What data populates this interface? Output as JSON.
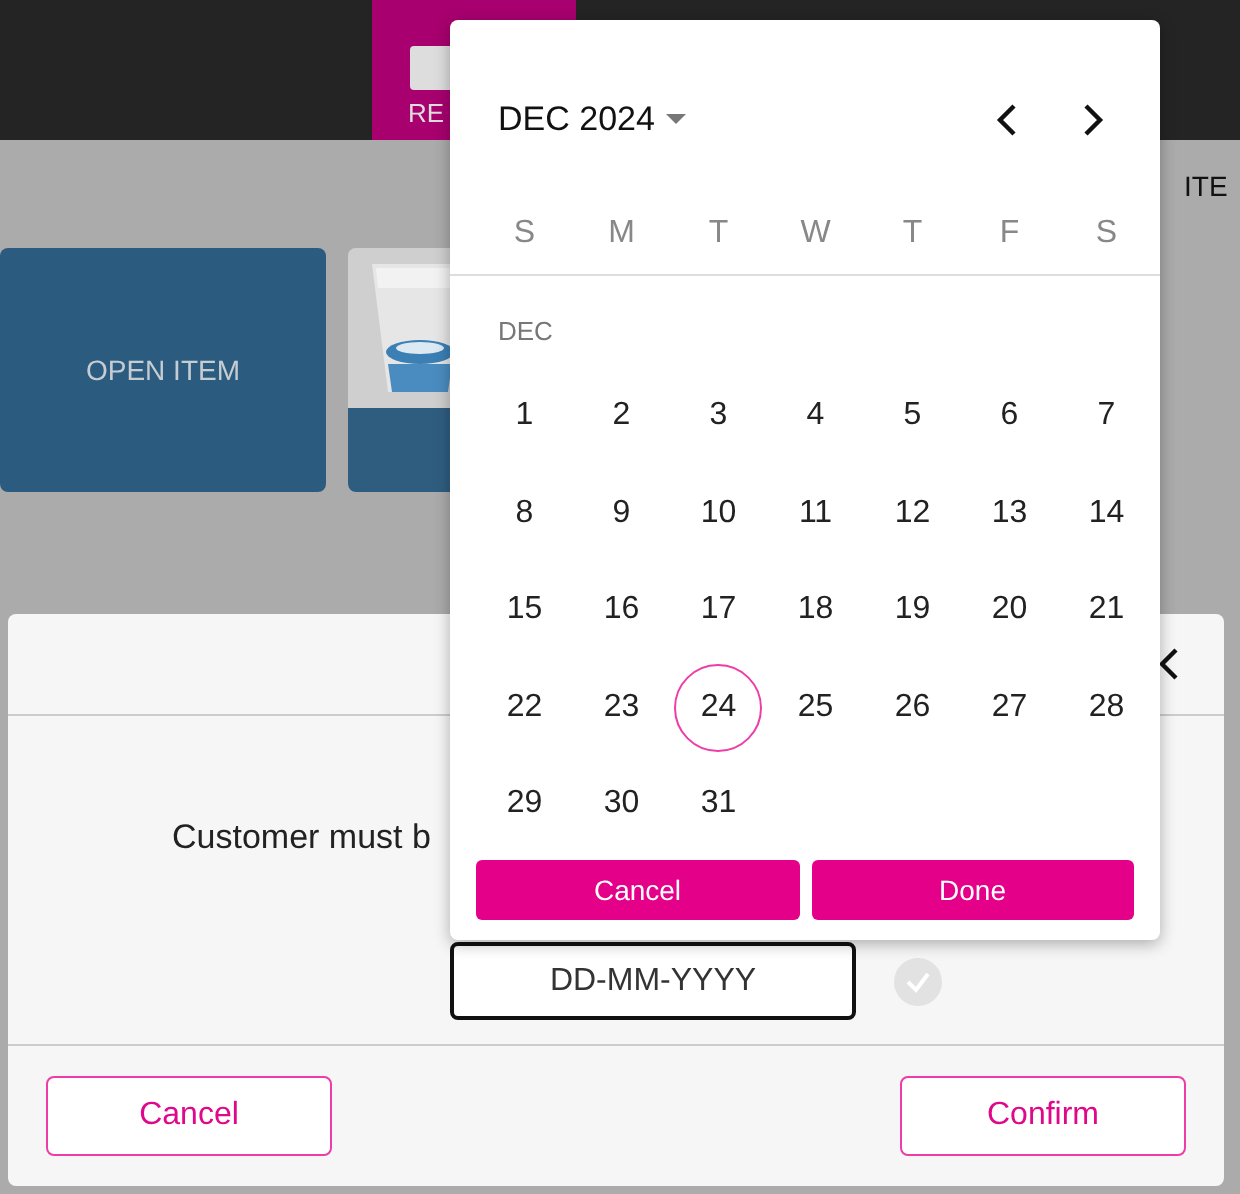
{
  "nav": {
    "active_tab": {
      "label": "RE",
      "selected": true
    }
  },
  "background": {
    "heading_fragment": "ITE",
    "cards": [
      {
        "kind": "text",
        "label": "OPEN ITEM"
      },
      {
        "kind": "picture"
      }
    ]
  },
  "dialog": {
    "message": "Customer must b",
    "date_field": {
      "placeholder": "DD-MM-YYYY"
    },
    "confirmed": false,
    "buttons": [
      "Cancel",
      "Confirm"
    ]
  },
  "date_picker": {
    "month_label": "DEC 2024",
    "weekdays": [
      "S",
      "M",
      "T",
      "W",
      "T",
      "F",
      "S"
    ],
    "section_label": "DEC",
    "days": [
      {
        "label": "1",
        "selected": false
      },
      {
        "label": "2",
        "selected": false
      },
      {
        "label": "3",
        "selected": false
      },
      {
        "label": "4",
        "selected": false
      },
      {
        "label": "5",
        "selected": false
      },
      {
        "label": "6",
        "selected": false
      },
      {
        "label": "7",
        "selected": false
      },
      {
        "label": "8",
        "selected": false
      },
      {
        "label": "9",
        "selected": false
      },
      {
        "label": "10",
        "selected": false
      },
      {
        "label": "11",
        "selected": false
      },
      {
        "label": "12",
        "selected": false
      },
      {
        "label": "13",
        "selected": false
      },
      {
        "label": "14",
        "selected": false
      },
      {
        "label": "15",
        "selected": false
      },
      {
        "label": "16",
        "selected": false
      },
      {
        "label": "17",
        "selected": false
      },
      {
        "label": "18",
        "selected": false
      },
      {
        "label": "19",
        "selected": false
      },
      {
        "label": "20",
        "selected": false
      },
      {
        "label": "21",
        "selected": false
      },
      {
        "label": "22",
        "selected": false
      },
      {
        "label": "23",
        "selected": false
      },
      {
        "label": "24",
        "selected": true
      },
      {
        "label": "25",
        "selected": false
      },
      {
        "label": "26",
        "selected": false
      },
      {
        "label": "27",
        "selected": false
      },
      {
        "label": "28",
        "selected": false
      },
      {
        "label": "29",
        "selected": false
      },
      {
        "label": "30",
        "selected": false
      },
      {
        "label": "31",
        "selected": false
      }
    ],
    "buttons": [
      "Cancel",
      "Done"
    ]
  }
}
